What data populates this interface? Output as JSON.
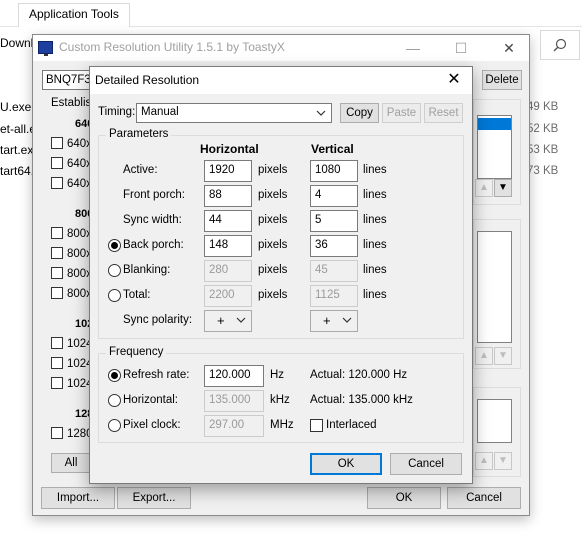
{
  "explorer": {
    "ribbon_tab": "Application Tools",
    "address_fragment": "Downl",
    "files": [
      {
        "name": "U.exe",
        "size": "49 KB"
      },
      {
        "name": "et-all.e",
        "size": "52 KB"
      },
      {
        "name": "tart.ex",
        "size": "53 KB"
      },
      {
        "name": "tart64.",
        "size": "73 KB"
      }
    ]
  },
  "cru": {
    "title": "Custom Resolution Utility 1.5.1 by ToastyX",
    "monitor": "BNQ7F33",
    "delete_label": "Delete",
    "section_label": "Establis",
    "groups": [
      {
        "label": "640",
        "rows": [
          "640x",
          "640x",
          "640x"
        ]
      },
      {
        "label": "800",
        "rows": [
          "800x",
          "800x",
          "800x",
          "800x"
        ]
      },
      {
        "label": "102",
        "rows": [
          "1024",
          "1024",
          "1024"
        ]
      },
      {
        "label": "128",
        "rows": [
          "1280"
        ]
      }
    ],
    "all_label": "All",
    "import_label": "Import...",
    "export_label": "Export...",
    "ok_label": "OK",
    "cancel_label": "Cancel"
  },
  "dialog": {
    "title": "Detailed Resolution",
    "timing_label": "Timing:",
    "timing_value": "Manual",
    "copy_label": "Copy",
    "paste_label": "Paste",
    "reset_label": "Reset",
    "parameters_label": "Parameters",
    "horizontal_header": "Horizontal",
    "vertical_header": "Vertical",
    "pixels_unit": "pixels",
    "lines_unit": "lines",
    "rows": [
      {
        "label": "Active:",
        "h": "1920",
        "v": "1080"
      },
      {
        "label": "Front porch:",
        "h": "88",
        "v": "4"
      },
      {
        "label": "Sync width:",
        "h": "44",
        "v": "5"
      },
      {
        "label": "Back porch:",
        "h": "148",
        "v": "36"
      },
      {
        "label": "Blanking:",
        "h": "280",
        "v": "45"
      },
      {
        "label": "Total:",
        "h": "2200",
        "v": "1125"
      }
    ],
    "sync_polarity_label": "Sync polarity:",
    "h_polarity": "+",
    "v_polarity": "+",
    "frequency_label": "Frequency",
    "refresh_label": "Refresh rate:",
    "refresh_value": "120.000",
    "refresh_unit": "Hz",
    "refresh_actual": "Actual: 120.000 Hz",
    "horizontal_label": "Horizontal:",
    "horizontal_value": "135.000",
    "horizontal_unit": "kHz",
    "horizontal_actual": "Actual: 135.000 kHz",
    "pixel_clock_label": "Pixel clock:",
    "pixel_clock_value": "297.00",
    "pixel_clock_unit": "MHz",
    "interlaced_label": "Interlaced",
    "ok_label": "OK",
    "cancel_label": "Cancel"
  }
}
